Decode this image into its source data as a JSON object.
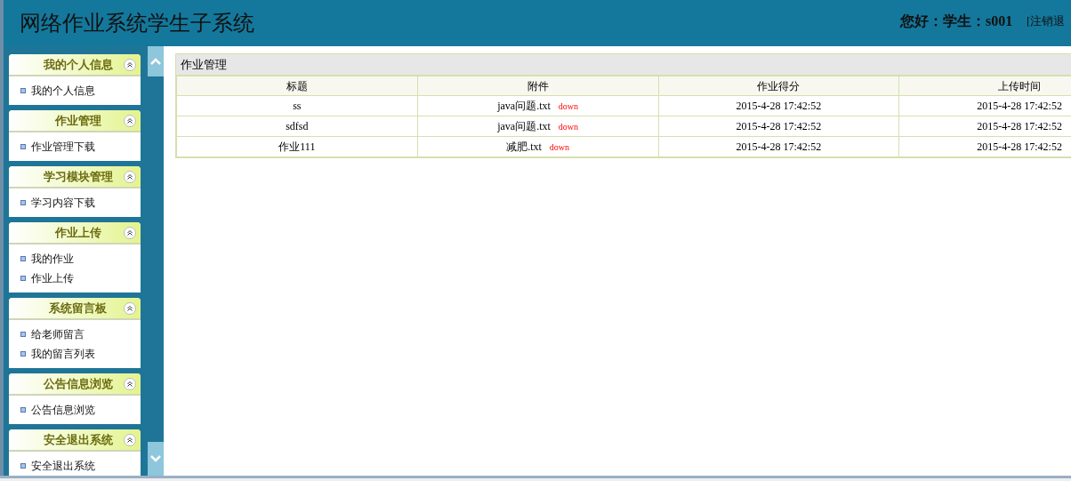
{
  "header": {
    "title": "网络作业系统学生子系统",
    "greeting": "您好：学生：s001",
    "logout": "[注销退"
  },
  "sidebar": [
    {
      "title": "我的个人信息",
      "items": [
        "我的个人信息"
      ]
    },
    {
      "title": "作业管理",
      "items": [
        "作业管理下载"
      ]
    },
    {
      "title": "学习模块管理",
      "items": [
        "学习内容下载"
      ]
    },
    {
      "title": "作业上传",
      "items": [
        "我的作业",
        "作业上传"
      ]
    },
    {
      "title": "系统留言板",
      "items": [
        "给老师留言",
        "我的留言列表"
      ]
    },
    {
      "title": "公告信息浏览",
      "items": [
        "公告信息浏览"
      ]
    },
    {
      "title": "安全退出系统",
      "items": [
        "安全退出系统"
      ]
    }
  ],
  "panel": {
    "title": "作业管理",
    "columns": [
      "标题",
      "附件",
      "作业得分",
      "上传时间"
    ],
    "rows": [
      {
        "title": "ss",
        "file": "java问题.txt",
        "link": "down",
        "score": "2015-4-28 17:42:52",
        "time": "2015-4-28 17:42:52"
      },
      {
        "title": "sdfsd",
        "file": "java问题.txt",
        "link": "down",
        "score": "2015-4-28 17:42:52",
        "time": "2015-4-28 17:42:52"
      },
      {
        "title": "作业111",
        "file": "减肥.txt",
        "link": "down",
        "score": "2015-4-28 17:42:52",
        "time": "2015-4-28 17:42:52"
      }
    ]
  }
}
